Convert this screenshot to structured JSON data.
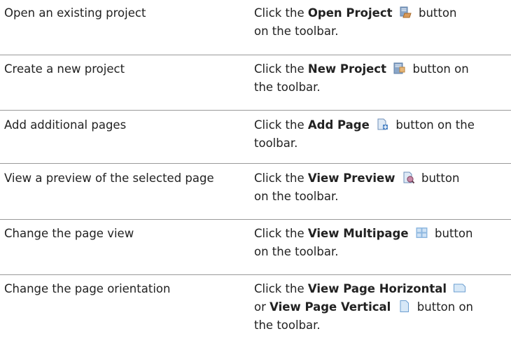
{
  "rows": [
    {
      "task": "Open an existing project",
      "prefix": "Click the",
      "button": "Open Project",
      "icon": "open-project-icon",
      "suffix_a": "button",
      "suffix_b": "on the toolbar."
    },
    {
      "task": "Create a new project",
      "prefix": "Click the",
      "button": "New Project",
      "icon": "new-project-icon",
      "suffix_a": "button on",
      "suffix_b": "the toolbar."
    },
    {
      "task": "Add additional pages",
      "prefix": "Click the",
      "button": "Add Page",
      "icon": "add-page-icon",
      "suffix_a": "button on the",
      "suffix_b": "toolbar."
    },
    {
      "task": "View a preview of the selected page",
      "prefix": "Click the",
      "button": "View Preview",
      "icon": "view-preview-icon",
      "suffix_a": "button",
      "suffix_b": "on the toolbar."
    },
    {
      "task": "Change the page view",
      "prefix": "Click the",
      "button": "View Multipage",
      "icon": "view-multipage-icon",
      "suffix_a": "button",
      "suffix_b": "on the toolbar."
    },
    {
      "task": "Change the page orientation",
      "prefix": "Click the",
      "button": "View Page Horizontal",
      "icon": "view-page-horizontal-icon",
      "connector": "or",
      "button2": "View Page Vertical",
      "icon2": "view-page-vertical-icon",
      "suffix_a": "button on",
      "suffix_b": "the toolbar."
    }
  ]
}
